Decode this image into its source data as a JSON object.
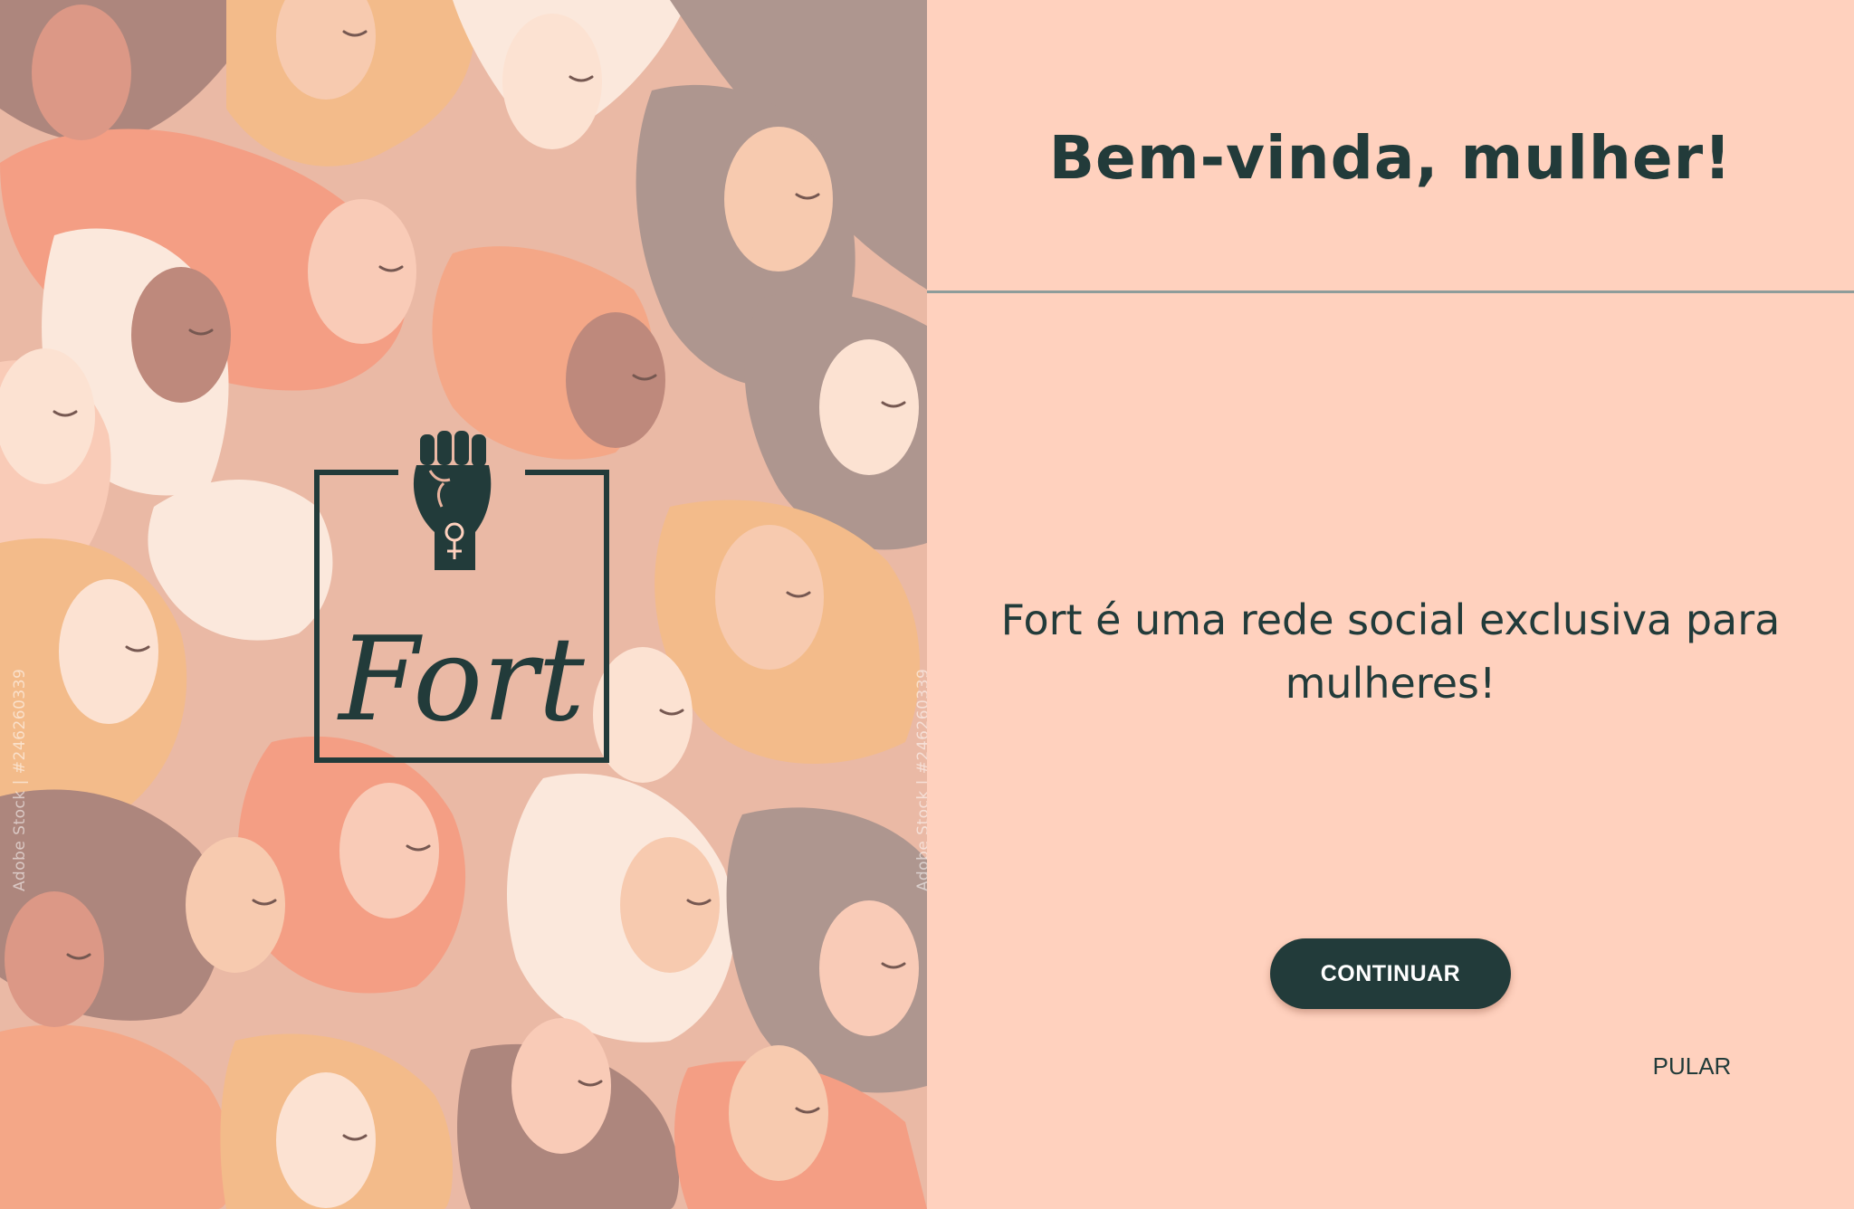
{
  "illustration": {
    "watermark_text": "Adobe Stock | #246260339"
  },
  "logo": {
    "icon": "raised-fist-female-symbol-icon",
    "wordmark": "Fort",
    "color": "#223B3A"
  },
  "welcome": {
    "title": "Bem-vinda, mulher!",
    "description": "Fort é uma rede social exclusiva para mulheres!",
    "continue_label": "CONTINUAR",
    "skip_label": "PULAR"
  },
  "colors": {
    "background": "#FFD1BE",
    "primary": "#223B3A",
    "divider": "#8E9C9A"
  }
}
